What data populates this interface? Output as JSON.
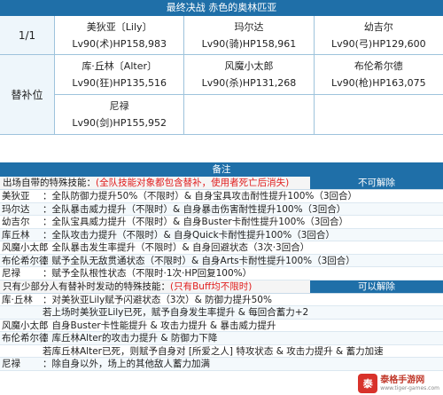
{
  "title": "最终决战 赤色的奥林匹亚",
  "rows": [
    {
      "label": "1/1",
      "cells": [
        {
          "name": "美狄亚〔Lily〕",
          "stat": "Lv90(术)HP158,983"
        },
        {
          "name": "玛尔达",
          "stat": "Lv90(骑)HP158,961"
        },
        {
          "name": "幼吉尔",
          "stat": "Lv90(弓)HP129,600"
        }
      ]
    },
    {
      "label": "替补位",
      "cells": [
        {
          "name": "库·丘林〔Alter〕",
          "stat": "Lv90(狂)HP135,516"
        },
        {
          "name": "风魔小太郎",
          "stat": "Lv90(杀)HP131,268"
        },
        {
          "name": "布伦希尔德",
          "stat": "Lv90(枪)HP163,075"
        }
      ]
    },
    {
      "cells": [
        {
          "name": "尼禄",
          "stat": "Lv90(剑)HP155,952"
        }
      ]
    }
  ],
  "remarks_header": "备注",
  "section1": {
    "prefix": "出场自带的特殊技能：",
    "note": "(全队技能对象都包含替补，使用者死亡后消失)",
    "tag": "不可解除",
    "lines": [
      {
        "name": "美狄亚",
        "desc": "：全队防御力提升50%（不限时）& 自身宝具攻击耐性提升100%（3回合）"
      },
      {
        "name": "玛尔达",
        "desc": "：全队暴击威力提升（不限时）& 自身暴击伤害耐性提升100%（3回合）"
      },
      {
        "name": "幼吉尔",
        "desc": "：全队宝具威力提升（不限时）& 自身Buster卡耐性提升100%（3回合）"
      },
      {
        "name": "库丘林",
        "desc": "：全队攻击力提升（不限时）& 自身Quick卡耐性提升100%（3回合）"
      },
      {
        "name": "风魔小太郎",
        "desc": "：全队暴击发生率提升（不限时）& 自身回避状态（3次·3回合）"
      },
      {
        "name": "布伦希尔德",
        "desc": "：赋予全队无敌贯通状态（不限时）& 自身Arts卡耐性提升100%（3回合）"
      },
      {
        "name": "尼禄",
        "desc": "：赋予全队根性状态（不限时·1次·HP回复100%）"
      }
    ]
  },
  "section2": {
    "prefix": "只有少部分人有替补时发动的特殊技能：",
    "note": "(只有Buff均不限时)",
    "tag": "可以解除",
    "lines": [
      {
        "name": "库·丘林",
        "desc": "：对美狄亚Lily赋予闪避状态（3次）& 防御力提升50%"
      },
      {
        "name": "",
        "desc": "  若上场时美狄亚Lily已死，赋予自身发生率提升 & 每回合蓄力+2"
      },
      {
        "name": "风魔小太郎",
        "desc": "：自身Buster卡性能提升 & 攻击力提升 & 暴击威力提升"
      },
      {
        "name": "布伦希尔德",
        "desc": "：库丘林Alter的攻击力提升 & 防御力下降"
      },
      {
        "name": "",
        "desc": "  若库丘林Alter已死，则赋予自身对 [所爱之人] 特攻状态 & 攻击力提升 & 蓄力加速"
      },
      {
        "name": "尼禄",
        "desc": "：除自身以外，场上的其他敌人蓄力加满"
      }
    ]
  },
  "watermark": {
    "title": "泰格手游网",
    "sub": "www.tiger-games.com"
  }
}
